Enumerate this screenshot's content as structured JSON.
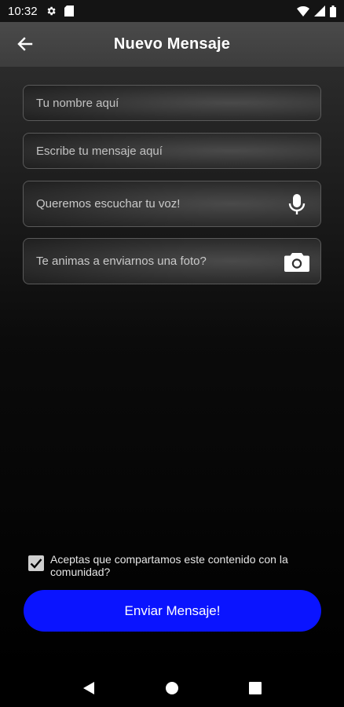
{
  "status_bar": {
    "time": "10:32",
    "icons": [
      "gear-icon",
      "sim-card-icon",
      "wifi-icon",
      "signal-icon",
      "battery-icon"
    ]
  },
  "app_bar": {
    "title": "Nuevo Mensaje",
    "back_icon": "arrow-left-icon"
  },
  "form": {
    "name_placeholder": "Tu nombre aquí",
    "message_placeholder": "Escribe tu mensaje aquí",
    "voice_placeholder": "Queremos escuchar tu voz!",
    "voice_icon": "microphone-icon",
    "photo_placeholder": "Te animas a enviarnos una foto?",
    "photo_icon": "camera-icon"
  },
  "consent": {
    "checked": true,
    "text": "Aceptas que compartamos este contenido con la comunidad?"
  },
  "send_button": {
    "label": "Enviar Mensaje!",
    "color": "#0a14ff"
  },
  "nav_bar": {
    "icons": [
      "back-triangle-icon",
      "home-circle-icon",
      "recents-square-icon"
    ]
  }
}
